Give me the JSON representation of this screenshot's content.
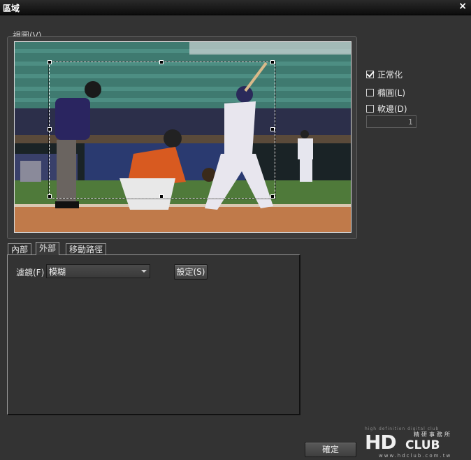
{
  "window": {
    "title": "區域",
    "close_glyph": "×"
  },
  "preview": {
    "group_label": "視圖(V)"
  },
  "options": {
    "normalize": {
      "label": "正常化",
      "checked": true
    },
    "ellipse": {
      "label": "橢圓(L)",
      "checked": false
    },
    "soft_edge": {
      "label": "軟邊(D)",
      "checked": false
    },
    "soft_edge_value": "1"
  },
  "tabs": [
    {
      "label": "內部",
      "active": false
    },
    {
      "label": "外部",
      "active": true
    },
    {
      "label": "移動路徑",
      "active": false
    }
  ],
  "panel": {
    "filter_label": "濾鏡(F)",
    "filter_value": "模糊",
    "settings_label": "設定(S)"
  },
  "footer": {
    "ok_label": "確定"
  },
  "watermark": {
    "tagline": "high definition digital club",
    "brand_main": "HD",
    "brand_sub": "CLUB",
    "brand_cn": "精研事務所",
    "url": "www.hdclub.com.tw"
  }
}
